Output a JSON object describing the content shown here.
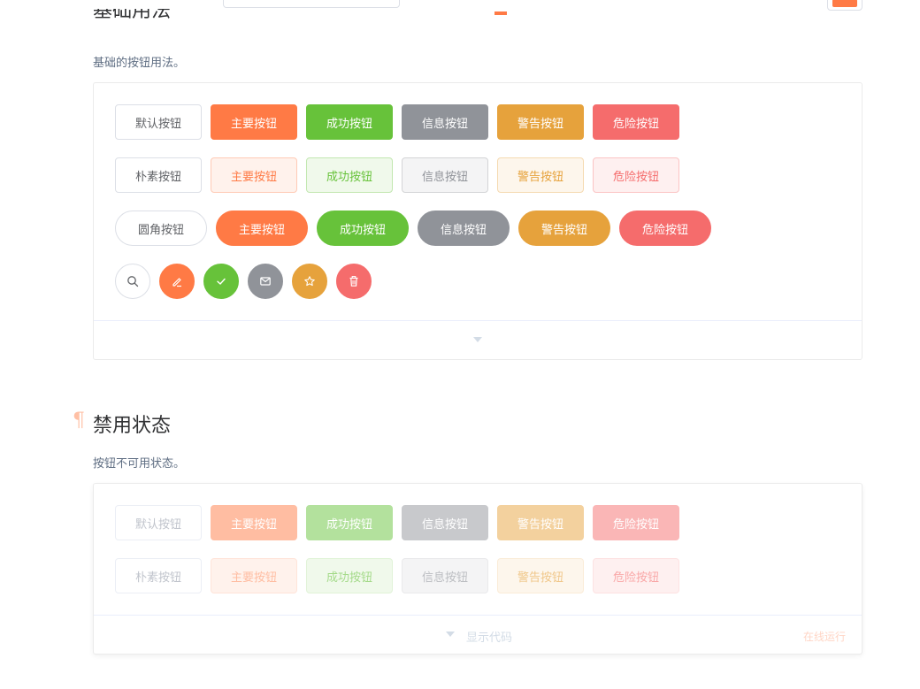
{
  "sections": [
    {
      "title": "基础用法",
      "description": "基础的按钮用法。",
      "rows": [
        {
          "variant": "default",
          "buttons": [
            "默认按钮",
            "主要按钮",
            "成功按钮",
            "信息按钮",
            "警告按钮",
            "危险按钮"
          ]
        },
        {
          "variant": "plain",
          "buttons": [
            "朴素按钮",
            "主要按钮",
            "成功按钮",
            "信息按钮",
            "警告按钮",
            "危险按钮"
          ]
        },
        {
          "variant": "round",
          "buttons": [
            "圆角按钮",
            "主要按钮",
            "成功按钮",
            "信息按钮",
            "警告按钮",
            "危险按钮"
          ]
        },
        {
          "variant": "circle",
          "icons": [
            "search-icon",
            "edit-icon",
            "check-icon",
            "message-icon",
            "star-icon",
            "delete-icon"
          ]
        }
      ]
    },
    {
      "title": "禁用状态",
      "description": "按钮不可用状态。",
      "anchor": "¶",
      "rows": [
        {
          "variant": "disabled",
          "buttons": [
            "默认按钮",
            "主要按钮",
            "成功按钮",
            "信息按钮",
            "警告按钮",
            "危险按钮"
          ]
        },
        {
          "variant": "disabled-plain",
          "buttons": [
            "朴素按钮",
            "主要按钮",
            "成功按钮",
            "信息按钮",
            "警告按钮",
            "危险按钮"
          ]
        }
      ],
      "footer": {
        "show_code": "显示代码",
        "run_online": "在线运行"
      }
    }
  ],
  "colors": {
    "primary": "#ff7a45",
    "success": "#67c23a",
    "info": "#909399",
    "warning": "#e6a23c",
    "danger": "#f56c6c"
  }
}
